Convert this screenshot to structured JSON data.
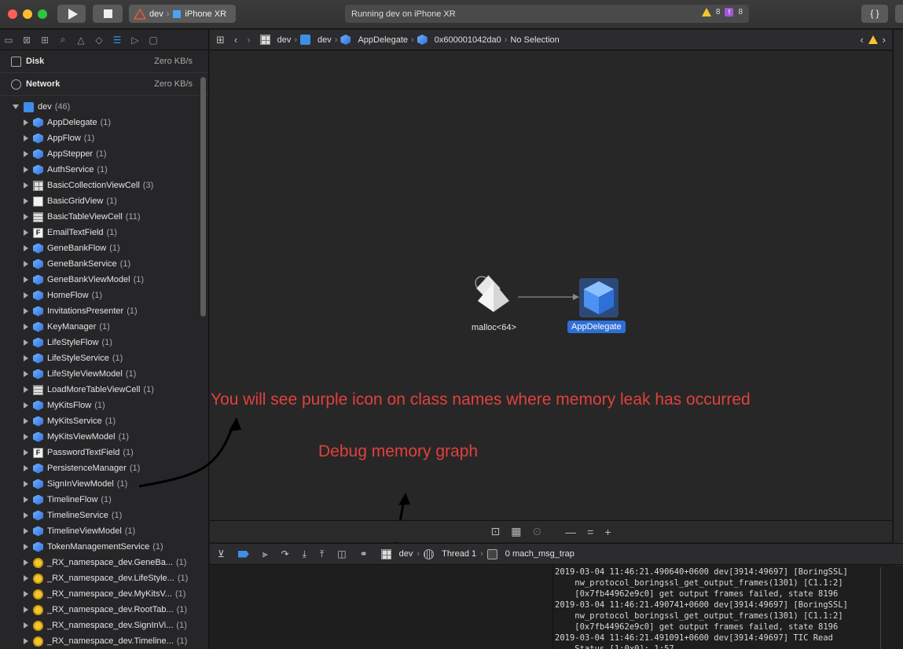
{
  "toolbar": {
    "scheme_target": "dev",
    "device": "iPhone XR",
    "activity_status": "Running dev on iPhone XR",
    "warnings_count": "8",
    "issues_count": "8",
    "braces_label": "{ }"
  },
  "gauges": [
    {
      "name": "Disk",
      "value": "Zero KB/s"
    },
    {
      "name": "Network",
      "value": "Zero KB/s"
    }
  ],
  "tree": {
    "root": {
      "name": "dev",
      "count": "(46)"
    },
    "items": [
      {
        "name": "AppDelegate",
        "count": "(1)",
        "icon": "cube"
      },
      {
        "name": "AppFlow",
        "count": "(1)",
        "icon": "cube"
      },
      {
        "name": "AppStepper",
        "count": "(1)",
        "icon": "cube"
      },
      {
        "name": "AuthService",
        "count": "(1)",
        "icon": "cube"
      },
      {
        "name": "BasicCollectionViewCell",
        "count": "(3)",
        "icon": "grid"
      },
      {
        "name": "BasicGridView",
        "count": "(1)",
        "icon": "view"
      },
      {
        "name": "BasicTableViewCell",
        "count": "(11)",
        "icon": "table"
      },
      {
        "name": "EmailTextField",
        "count": "(1)",
        "icon": "field"
      },
      {
        "name": "GeneBankFlow",
        "count": "(1)",
        "icon": "cube"
      },
      {
        "name": "GeneBankService",
        "count": "(1)",
        "icon": "cube"
      },
      {
        "name": "GeneBankViewModel",
        "count": "(1)",
        "icon": "cube"
      },
      {
        "name": "HomeFlow",
        "count": "(1)",
        "icon": "cube"
      },
      {
        "name": "InvitationsPresenter",
        "count": "(1)",
        "icon": "cube"
      },
      {
        "name": "KeyManager",
        "count": "(1)",
        "icon": "cube"
      },
      {
        "name": "LifeStyleFlow",
        "count": "(1)",
        "icon": "cube"
      },
      {
        "name": "LifeStyleService",
        "count": "(1)",
        "icon": "cube"
      },
      {
        "name": "LifeStyleViewModel",
        "count": "(1)",
        "icon": "cube"
      },
      {
        "name": "LoadMoreTableViewCell",
        "count": "(1)",
        "icon": "table"
      },
      {
        "name": "MyKitsFlow",
        "count": "(1)",
        "icon": "cube"
      },
      {
        "name": "MyKitsService",
        "count": "(1)",
        "icon": "cube"
      },
      {
        "name": "MyKitsViewModel",
        "count": "(1)",
        "icon": "cube"
      },
      {
        "name": "PasswordTextField",
        "count": "(1)",
        "icon": "field"
      },
      {
        "name": "PersistenceManager",
        "count": "(1)",
        "icon": "cube"
      },
      {
        "name": "SignInViewModel",
        "count": "(1)",
        "icon": "cube"
      },
      {
        "name": "TimelineFlow",
        "count": "(1)",
        "icon": "cube"
      },
      {
        "name": "TimelineService",
        "count": "(1)",
        "icon": "cube"
      },
      {
        "name": "TimelineViewModel",
        "count": "(1)",
        "icon": "cube"
      },
      {
        "name": "TokenManagementService",
        "count": "(1)",
        "icon": "cube"
      },
      {
        "name": "_RX_namespace_dev.GeneBa...",
        "count": "(1)",
        "icon": "ns"
      },
      {
        "name": "_RX_namespace_dev.LifeStyle...",
        "count": "(1)",
        "icon": "ns"
      },
      {
        "name": "_RX_namespace_dev.MyKitsV...",
        "count": "(1)",
        "icon": "ns"
      },
      {
        "name": "_RX_namespace_dev.RootTab...",
        "count": "(1)",
        "icon": "ns"
      },
      {
        "name": "_RX_namespace_dev.SignInVi...",
        "count": "(1)",
        "icon": "ns"
      },
      {
        "name": "_RX_namespace_dev.Timeline...",
        "count": "(1)",
        "icon": "ns"
      }
    ]
  },
  "jumpbar": {
    "crumbs": [
      "dev",
      "dev",
      "AppDelegate",
      "0x600001042da0",
      "No Selection"
    ]
  },
  "graph": {
    "source_label": "malloc<64>",
    "target_label": "AppDelegate"
  },
  "annotations": {
    "leak_note": "You will see purple icon on class names where memory leak has occurred",
    "graph_note": "Debug memory graph"
  },
  "canvas_tools": {
    "zoom_out": "—",
    "zoom_fit": "=",
    "zoom_in": "+"
  },
  "debugbar": {
    "crumbs": [
      "dev",
      "Thread 1",
      "0 mach_msg_trap"
    ]
  },
  "console": {
    "lines": [
      "2019-03-04 11:46:21.490640+0600 dev[3914:49697] [BoringSSL]",
      "    nw_protocol_boringssl_get_output_frames(1301) [C1.1:2]",
      "    [0x7fb44962e9c0] get output frames failed, state 8196",
      "2019-03-04 11:46:21.490741+0600 dev[3914:49697] [BoringSSL]",
      "    nw_protocol_boringssl_get_output_frames(1301) [C1.1:2]",
      "    [0x7fb44962e9c0] get output frames failed, state 8196",
      "2019-03-04 11:46:21.491091+0600 dev[3914:49697] TIC Read",
      "    Status [1:0x0]: 1:57"
    ]
  },
  "colors": {
    "accent": "#3d8fe8",
    "selection": "#2f6fd6",
    "annotation": "#e0413a",
    "warning": "#f5c531",
    "issue": "#a259d9"
  }
}
